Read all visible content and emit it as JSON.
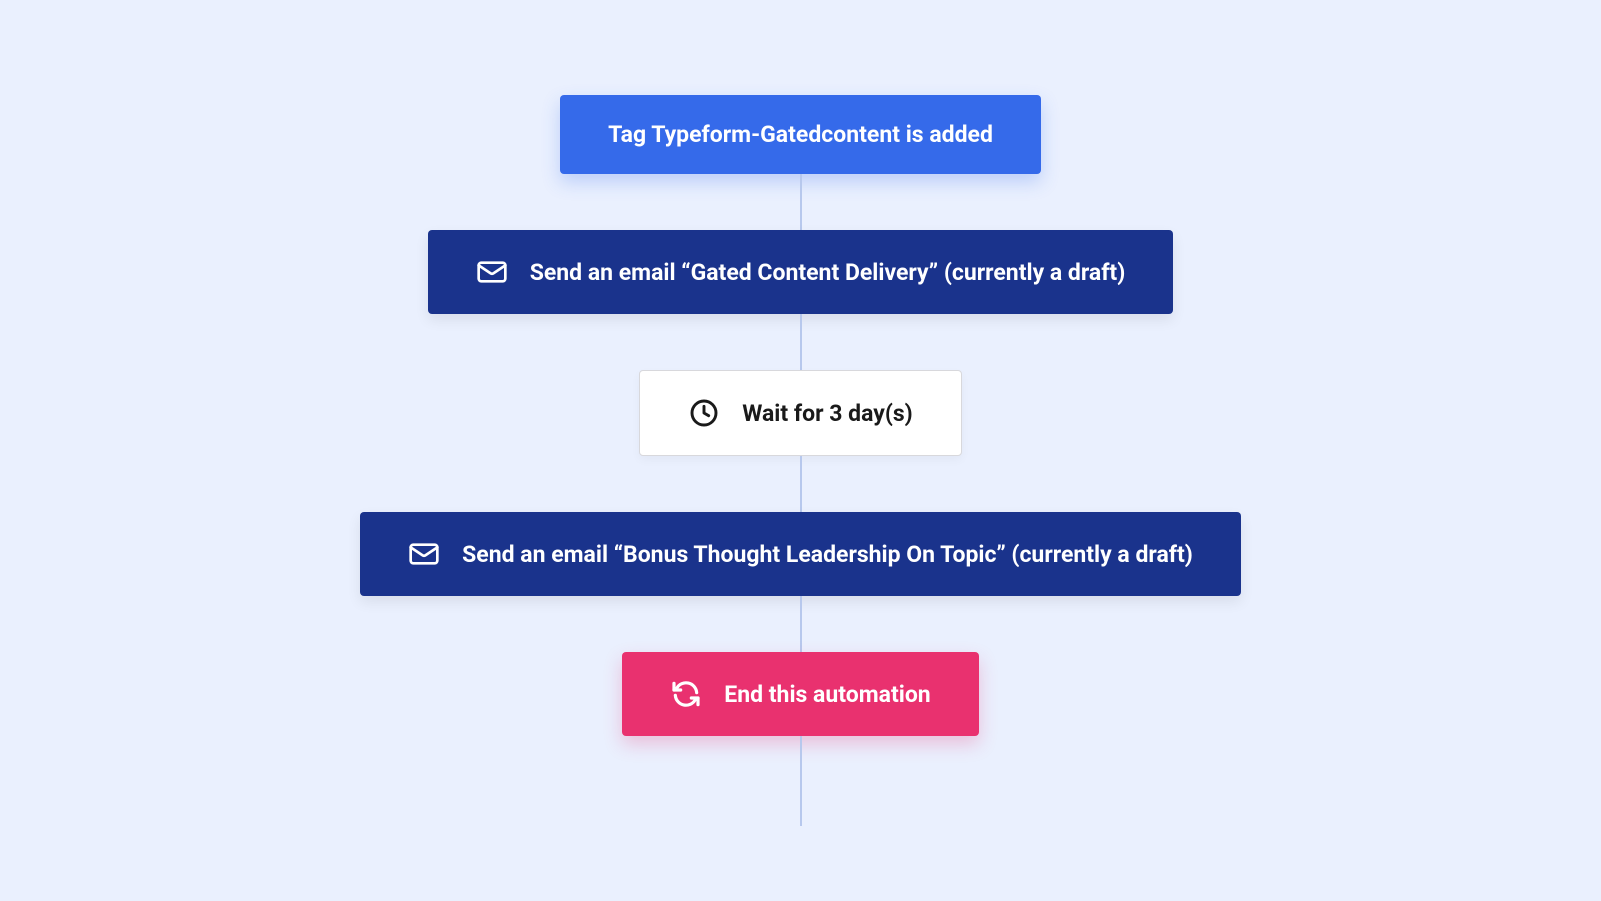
{
  "automation": {
    "trigger": {
      "label": "Tag Typeform-Gatedcontent is added"
    },
    "steps": [
      {
        "type": "send_email",
        "icon": "mail",
        "label": "Send an email “Gated Content Delivery” (currently a draft)"
      },
      {
        "type": "wait",
        "icon": "clock",
        "label": "Wait for 3 day(s)"
      },
      {
        "type": "send_email",
        "icon": "mail",
        "label": "Send an email “Bonus Thought Leadership On Topic” (currently a draft)"
      },
      {
        "type": "end",
        "icon": "refresh",
        "label": "End this automation"
      }
    ]
  },
  "colors": {
    "trigger_bg": "#356aea",
    "action_bg": "#1a338c",
    "wait_bg": "#ffffff",
    "end_bg": "#e9316f",
    "canvas_bg": "#eaf0fe",
    "connector": "#b7c8ed"
  }
}
